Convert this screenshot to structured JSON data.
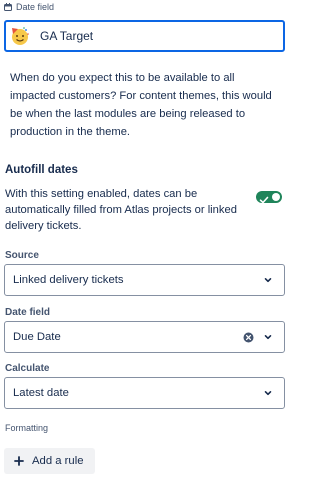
{
  "header": {
    "label": "Date field",
    "label_icon": "calendar-icon"
  },
  "name_field": {
    "value": "GA Target",
    "emoji": "party-face-emoji"
  },
  "description": "When do you expect this to be available to all impacted customers? For content themes, this would be when the last modules are being released to production in the theme.",
  "autofill": {
    "title": "Autofill dates",
    "description": "With this setting enabled, dates can be automatically filled from Atlas projects or linked delivery tickets.",
    "enabled": true,
    "toggle_color": "#1f845a"
  },
  "source": {
    "label": "Source",
    "value": "Linked delivery tickets"
  },
  "date_field": {
    "label": "Date field",
    "value": "Due Date"
  },
  "calculate": {
    "label": "Calculate",
    "value": "Latest date"
  },
  "formatting": {
    "label": "Formatting",
    "add_rule_label": "Add a rule"
  },
  "colors": {
    "focus_border": "#0c66e4",
    "text": "#172b4d",
    "subtle_text": "#44546f"
  }
}
